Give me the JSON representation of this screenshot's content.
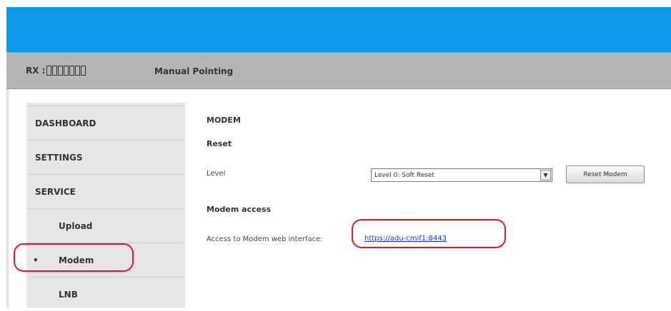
{
  "header": {
    "rx_label": "RX :",
    "page_title": "Manual Pointing"
  },
  "sidebar": {
    "items": [
      {
        "label": "DASHBOARD"
      },
      {
        "label": "SETTINGS"
      },
      {
        "label": "SERVICE"
      },
      {
        "label": "Upload"
      },
      {
        "label": "Modem",
        "active": true
      },
      {
        "label": "LNB"
      }
    ],
    "bullet": "•"
  },
  "main": {
    "section_title": "MODEM",
    "reset_heading": "Reset",
    "level_label": "Level",
    "level_select_value": "Level 0: Soft Reset",
    "reset_button": "Reset Modem",
    "modem_access_heading": "Modem access",
    "access_text": "Access to Modem web interface:",
    "access_link": "https://adu-cmif1:8443"
  },
  "colors": {
    "topbar": "#0a9ae6",
    "statusbar": "#b5b5b5",
    "highlight": "#e0182b",
    "link": "#1a3ab8"
  }
}
